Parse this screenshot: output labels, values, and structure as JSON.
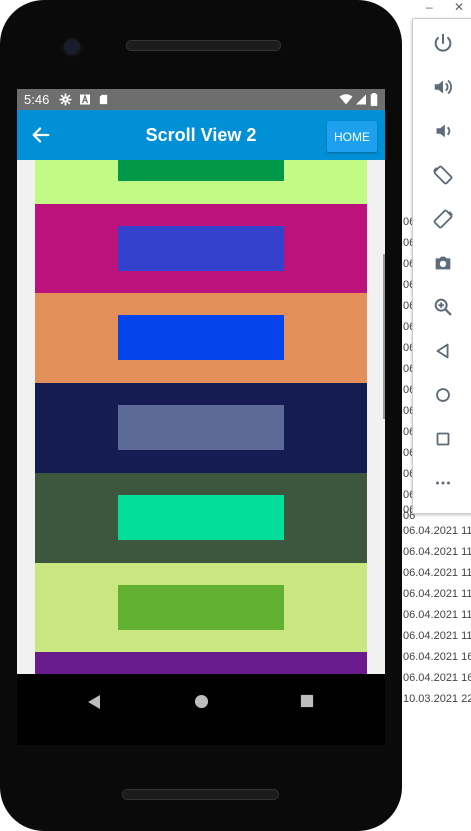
{
  "background_log": {
    "lines": [
      "06.04.2021 11",
      "06.04.2021 11",
      "06.04.2021 11",
      "06.04.2021 11",
      "06.04.2021 11",
      "06.04.2021 11",
      "06.04.2021 11",
      "06.04.2021 16",
      "06.04.2021 16",
      "10.03.2021 22"
    ],
    "partial": [
      "06",
      "06",
      "06",
      "06",
      "06",
      "06",
      "06",
      "06",
      "06",
      "06",
      "06",
      "06",
      "06",
      "06",
      "06"
    ]
  },
  "window_controls": {
    "minimize": "–",
    "close": "✕"
  },
  "toolbar": {
    "buttons": [
      "power",
      "volume-up",
      "volume-down",
      "rotate-left",
      "rotate-right",
      "camera",
      "zoom",
      "back",
      "home",
      "overview",
      "more"
    ]
  },
  "status_bar": {
    "time": "5:46"
  },
  "app_bar": {
    "title": "Scroll View 2",
    "home_label": "HOME"
  },
  "stripes": [
    {
      "outer": "#c3f985",
      "inner": "#02984a"
    },
    {
      "outer": "#bc127c",
      "inner": "#3341cd"
    },
    {
      "outer": "#e28f5a",
      "inner": "#0543ed"
    },
    {
      "outer": "#151c52",
      "inner": "#5d6996"
    },
    {
      "outer": "#3c573e",
      "inner": "#03df9b"
    },
    {
      "outer": "#cae681",
      "inner": "#61b031"
    },
    {
      "outer": "#6a1b8d",
      "inner": "#84963e"
    }
  ],
  "colors": {
    "app_bar": "#0190d6",
    "home_button": "#1da1ee",
    "status_bar": "#6e6e6e"
  }
}
